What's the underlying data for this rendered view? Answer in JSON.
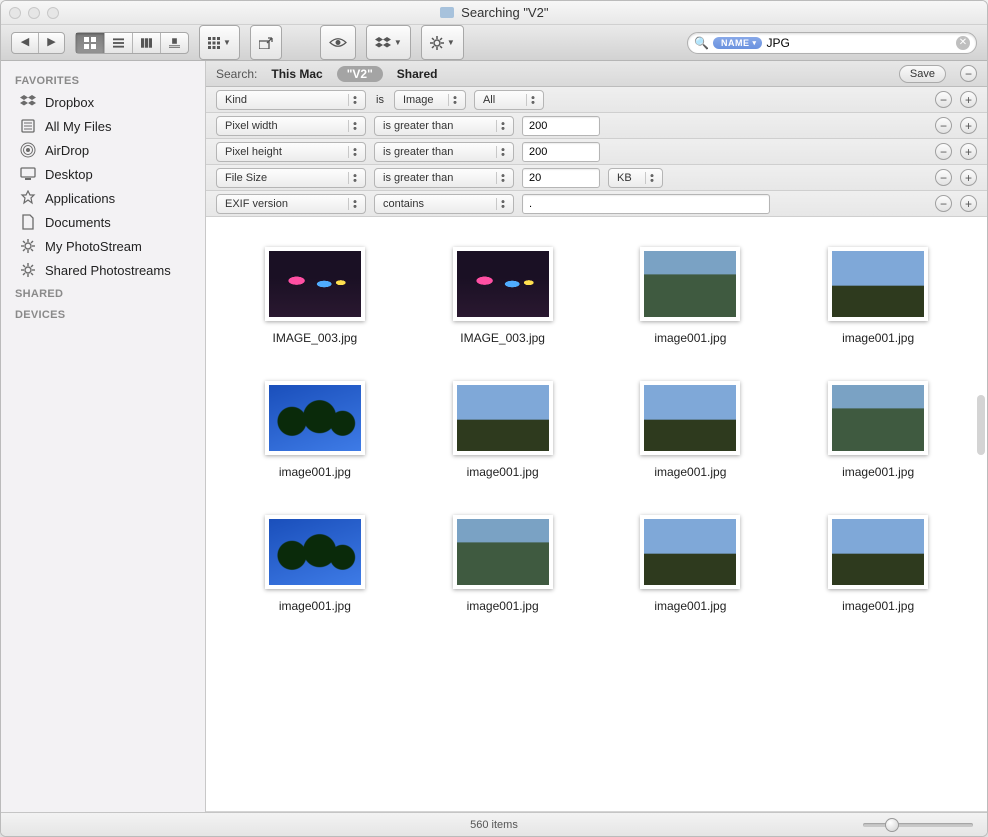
{
  "window": {
    "title": "Searching \"V2\""
  },
  "search": {
    "pill": "NAME",
    "value": "JPG"
  },
  "sidebar": {
    "sections": [
      {
        "header": "FAVORITES",
        "items": [
          {
            "label": "Dropbox",
            "icon": "dropbox"
          },
          {
            "label": "All My Files",
            "icon": "allfiles"
          },
          {
            "label": "AirDrop",
            "icon": "airdrop"
          },
          {
            "label": "Desktop",
            "icon": "desktop"
          },
          {
            "label": "Applications",
            "icon": "apps"
          },
          {
            "label": "Documents",
            "icon": "docs"
          },
          {
            "label": "My PhotoStream",
            "icon": "gear"
          },
          {
            "label": "Shared Photostreams",
            "icon": "gear"
          }
        ]
      },
      {
        "header": "SHARED",
        "items": []
      },
      {
        "header": "DEVICES",
        "items": []
      }
    ]
  },
  "scope": {
    "label": "Search:",
    "options": [
      "This Mac",
      "\"V2\"",
      "Shared"
    ],
    "active": 1,
    "save": "Save"
  },
  "criteria": [
    {
      "attr": "Kind",
      "op_label": "is",
      "op": "Image",
      "extra_sel": "All"
    },
    {
      "attr": "Pixel width",
      "op": "is greater than",
      "value": "200"
    },
    {
      "attr": "Pixel height",
      "op": "is greater than",
      "value": "200"
    },
    {
      "attr": "File Size",
      "op": "is greater than",
      "value": "20",
      "unit": "KB"
    },
    {
      "attr": "EXIF version",
      "op": "contains",
      "value": ".",
      "wide": true
    }
  ],
  "results": {
    "items": [
      {
        "name": "IMAGE_003.jpg",
        "t": "t-dark"
      },
      {
        "name": "IMAGE_003.jpg",
        "t": "t-dark"
      },
      {
        "name": "image001.jpg",
        "t": "t-work"
      },
      {
        "name": "image001.jpg",
        "t": "t-field"
      },
      {
        "name": "image001.jpg",
        "t": "t-palms"
      },
      {
        "name": "image001.jpg",
        "t": "t-field"
      },
      {
        "name": "image001.jpg",
        "t": "t-field"
      },
      {
        "name": "image001.jpg",
        "t": "t-work"
      },
      {
        "name": "image001.jpg",
        "t": "t-palms"
      },
      {
        "name": "image001.jpg",
        "t": "t-work"
      },
      {
        "name": "image001.jpg",
        "t": "t-field"
      },
      {
        "name": "image001.jpg",
        "t": "t-field"
      }
    ]
  },
  "status": {
    "text": "560 items"
  }
}
